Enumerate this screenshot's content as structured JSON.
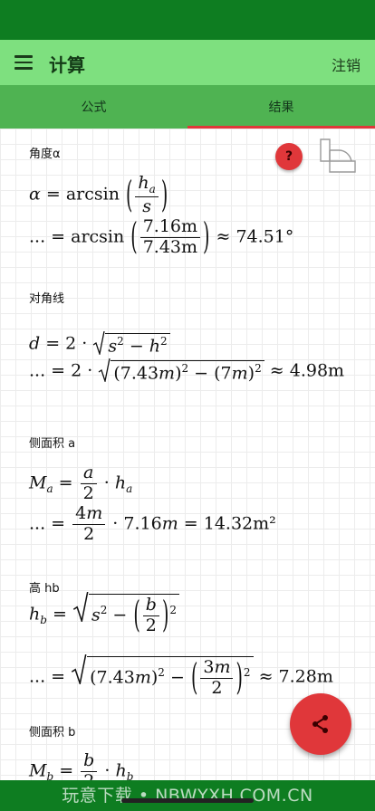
{
  "app": {
    "title": "计算",
    "logout_label": "注销"
  },
  "tabs": [
    {
      "label": "公式",
      "active": false
    },
    {
      "label": "结果",
      "active": true
    }
  ],
  "sections": {
    "angle_alpha": {
      "label": "角度α",
      "line1_result": "",
      "line2_values": [
        "7.16m",
        "7.43m"
      ],
      "line2_result": "≈ 74.51°"
    },
    "diagonal": {
      "label": "对角线",
      "line2_result": "≈ 4.98m"
    },
    "lateral_a": {
      "label": "侧面积 a",
      "line2_result": "= 14.32m²"
    },
    "height_hb": {
      "label": "高 hb",
      "line2_result": "≈ 7.28m"
    },
    "lateral_b": {
      "label": "侧面积 b"
    }
  },
  "help_label": "?",
  "watermark": "玩意下载 • NBWYXH.COM.CN",
  "colors": {
    "status": "#0e7d21",
    "appbar": "#7ee07f",
    "tabs": "#4fb352",
    "accent": "#e0373a"
  },
  "icons": [
    "menu-icon",
    "help-icon",
    "pyramid-shape-icon",
    "share-icon"
  ]
}
